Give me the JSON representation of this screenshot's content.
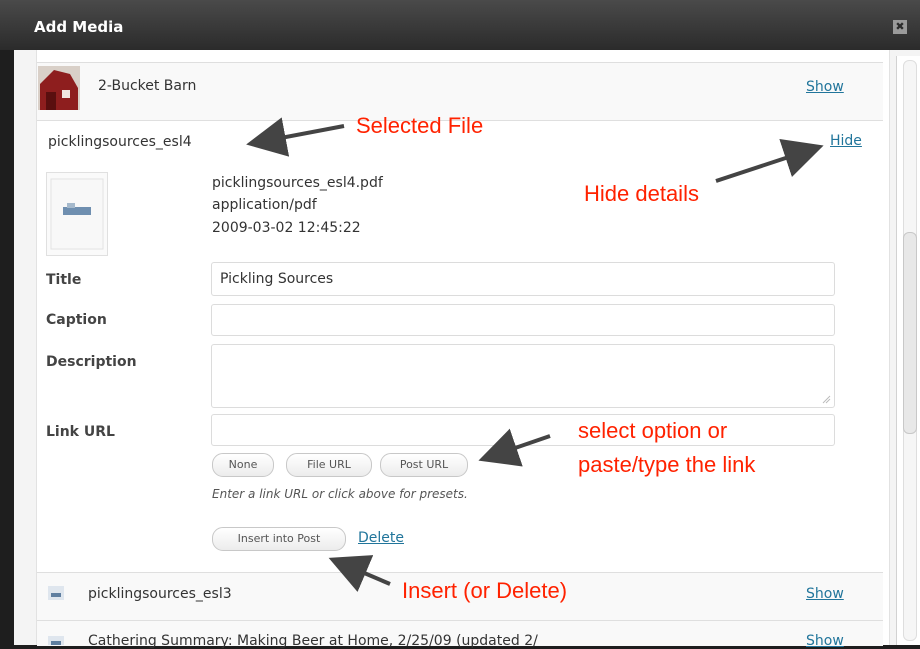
{
  "dialog": {
    "title": "Add Media",
    "close_glyph": "✖"
  },
  "items": [
    {
      "name": "2-Bucket Barn",
      "action": "Show"
    },
    {
      "name": "picklingsources_esl4",
      "action": "Hide"
    },
    {
      "name": "picklingsources_esl3",
      "action": "Show"
    },
    {
      "name": "Cathering Summary: Making Beer at Home, 2/25/09 (updated 2/",
      "action": "Show"
    }
  ],
  "file_details": {
    "filename": "picklingsources_esl4.pdf",
    "mime": "application/pdf",
    "date": "2009-03-02 12:45:22"
  },
  "form": {
    "title_label": "Title",
    "title_value": "Pickling Sources",
    "caption_label": "Caption",
    "caption_value": "",
    "description_label": "Description",
    "description_value": "",
    "link_label": "Link URL",
    "link_value": "",
    "presets": [
      "None",
      "File URL",
      "Post URL"
    ],
    "hint": "Enter a link URL or click above for presets.",
    "insert_label": "Insert into Post",
    "delete_label": "Delete"
  },
  "annotations": {
    "selected_file": "Selected File",
    "hide_details": "Hide details",
    "select_option_1": "select option or",
    "select_option_2": "paste/type the link",
    "insert": "Insert (or Delete)"
  },
  "icons": {
    "close": "close-icon",
    "barn_thumb": "barn-thumbnail-icon",
    "pdf_thumb": "pdf-document-icon",
    "file_small": "file-icon"
  }
}
